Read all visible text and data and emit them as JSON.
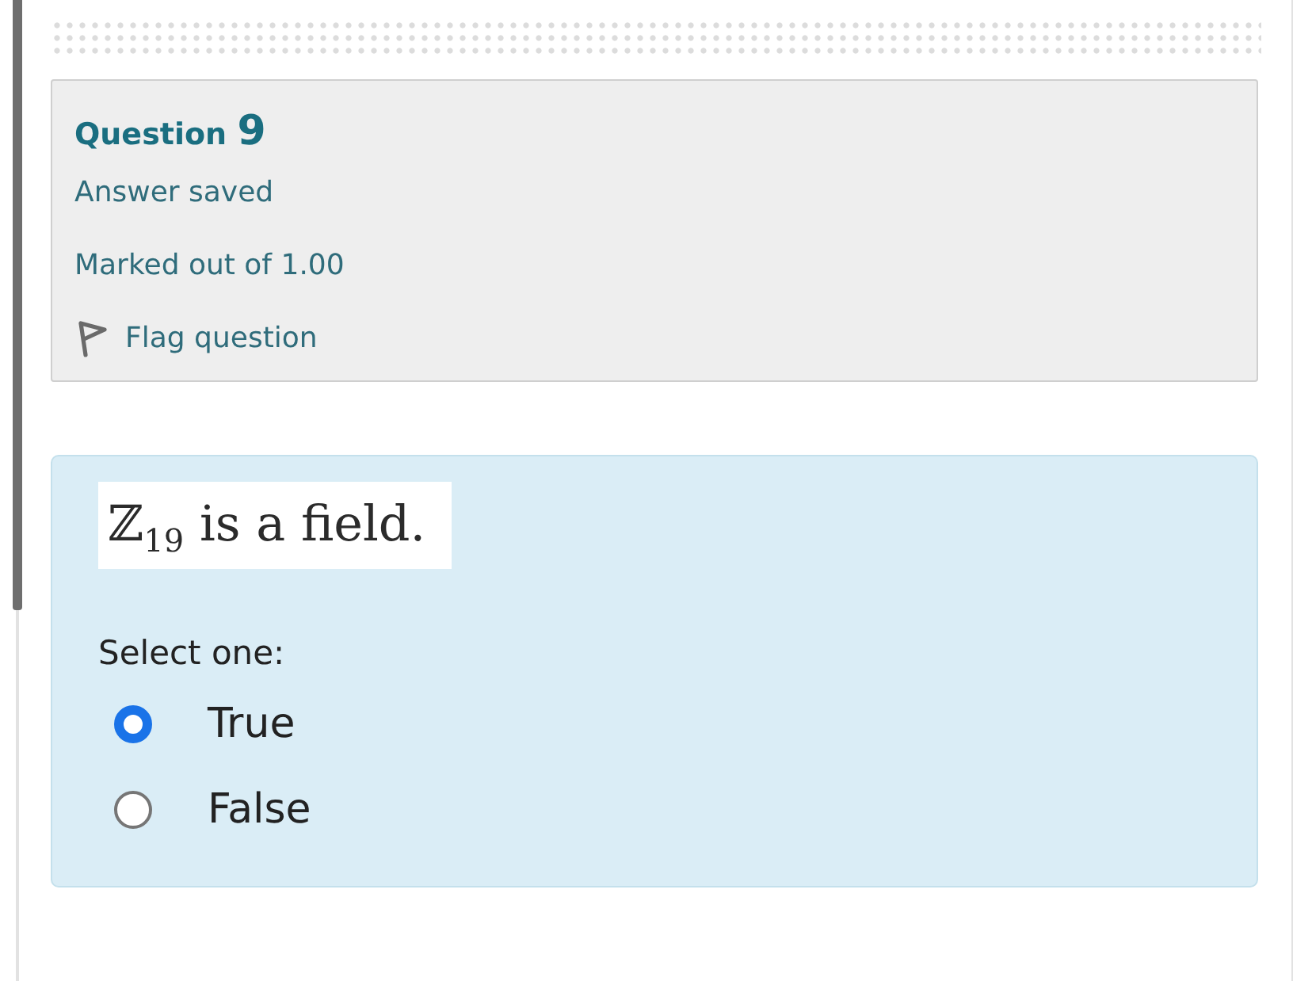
{
  "question_info": {
    "label": "Question",
    "number": "9",
    "status": "Answer saved",
    "mark": "Marked out of 1.00",
    "flag": {
      "label": "Flag question"
    }
  },
  "question": {
    "text": "ℤ$_{19}$ is a field.",
    "prompt": "Select one:",
    "options": [
      {
        "label": "True",
        "selected": true
      },
      {
        "label": "False",
        "selected": false
      }
    ]
  }
}
